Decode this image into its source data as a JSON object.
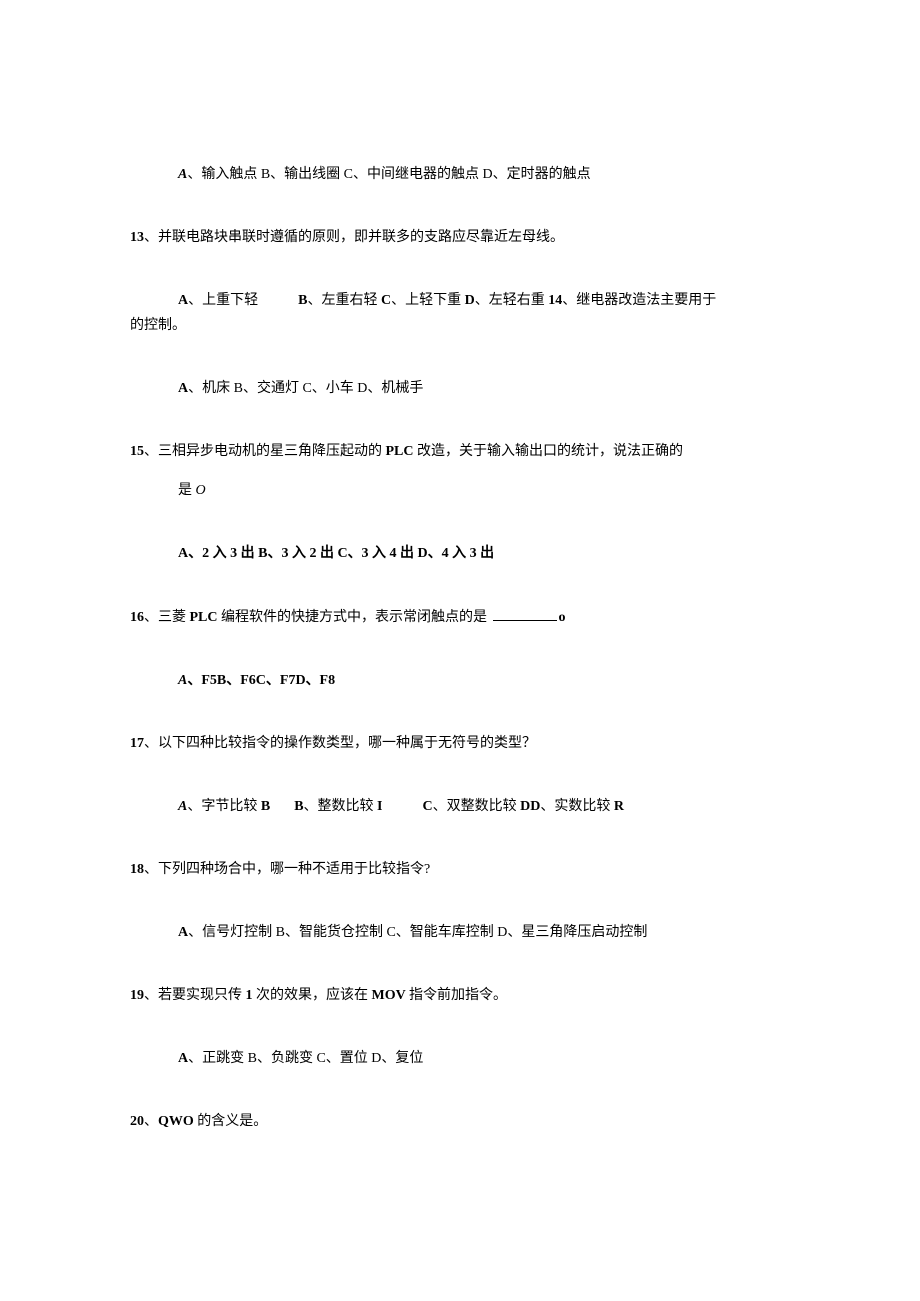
{
  "q12": {
    "options": "A、输入触点 B、输出线圈 C、中间继电器的触点 D、定时器的触点"
  },
  "q13": {
    "num": "13",
    "sep": "、",
    "text": "并联电路块串联时遵循的原则，即并联多的支路应尽靠近左母线。",
    "opt_a": "A",
    "opt_a_text": "、上重下轻",
    "opt_b": "B",
    "opt_b_text": "、左重右轻 ",
    "opt_c": "C",
    "opt_c_text": "、上轻下重 ",
    "opt_d": "D",
    "opt_d_text": "、左轻右重 ",
    "q14_num": "14",
    "q14_text": "、继电器改造法主要用于",
    "wrap_text": "的控制。"
  },
  "q14opts": {
    "text": "A、机床 B、交通灯 C、小车 D、机械手"
  },
  "q15": {
    "num": "15",
    "sep": "、",
    "line1_a": "三相异步电动机的星三角降压起动的 ",
    "line1_b": "PLC ",
    "line1_c": "改造，关于输入输出口的统计，说法正确的",
    "line2_a": "是 ",
    "line2_b": "O",
    "options": "A、2 入 3 出 B、3 入 2 出 C、3 入 4 出 D、4 入 3 出"
  },
  "q16": {
    "num": "16",
    "sep": "、",
    "text_a": "三菱 ",
    "text_b": "PLC ",
    "text_c": "编程软件的快捷方式中，表示常闭触点的是 ",
    "text_d": "o",
    "opt_a_i": "A",
    "options_rest": "、F5B、F6C、F7D、F8"
  },
  "q17": {
    "num": "17",
    "sep": "、",
    "text": "以下四种比较指令的操作数类型，哪一种属于无符号的类型？",
    "opt_a_i": "A",
    "opt_a_t": "、字节比较 ",
    "opt_a_b": "B",
    "opt_b": "B",
    "opt_b_t": "、整数比较 ",
    "opt_b_b": "I",
    "opt_c": "C",
    "opt_c_t": "、双整数比较 ",
    "opt_c_b": "DD",
    "opt_d_t": "、实数比较 ",
    "opt_d_b": "R"
  },
  "q18": {
    "num": "18",
    "sep": "、",
    "text": "下列四种场合中，哪一种不适用于比较指令?",
    "options": "A、信号灯控制 B、智能货仓控制 C、智能车库控制 D、星三角降压启动控制"
  },
  "q19": {
    "num": "19",
    "sep": "、",
    "text_a": "若要实现只传 ",
    "text_b": "1 ",
    "text_c": "次的效果，应该在 ",
    "text_d": "MOV ",
    "text_e": "指令前加指令。",
    "options": "A、正跳变 B、负跳变 C、置位 D、复位"
  },
  "q20": {
    "num": "20",
    "sep": "、",
    "text_a": "QWO ",
    "text_b": "的含义是。"
  }
}
